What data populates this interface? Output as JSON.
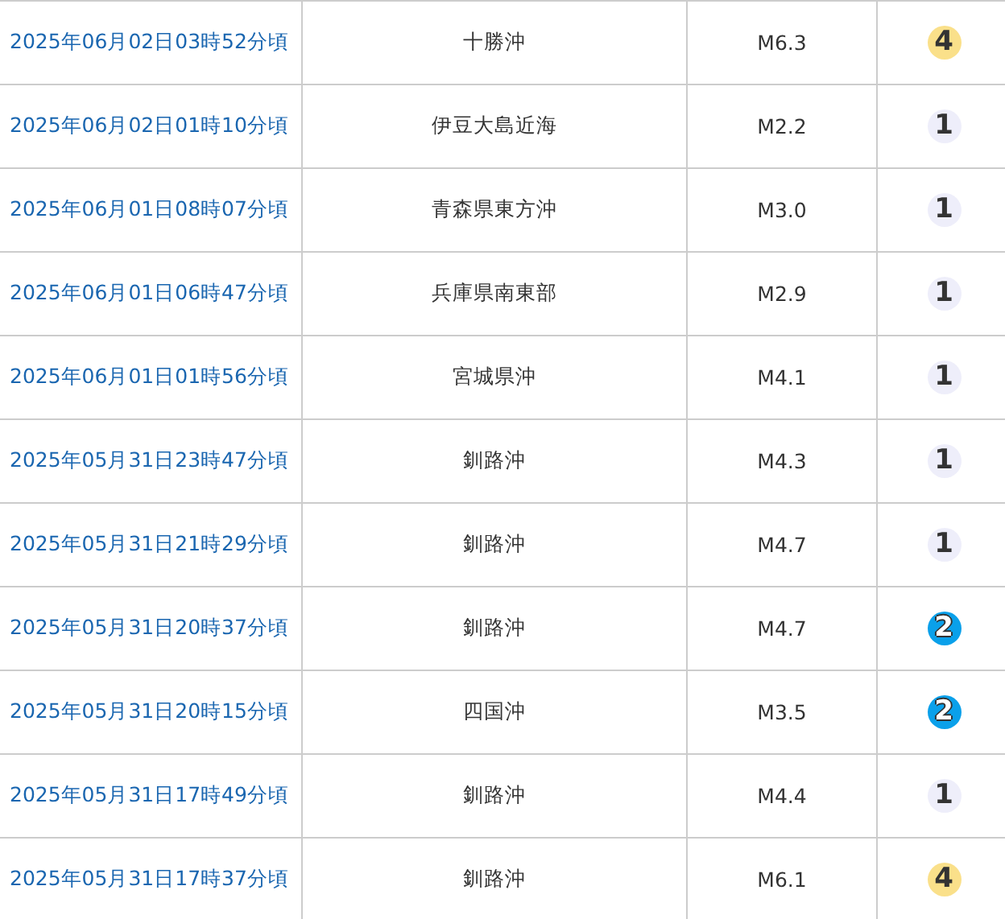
{
  "rows": [
    {
      "time": "2025年06月02日03時52分頃",
      "place": "十勝沖",
      "magnitude": "M6.3",
      "intensity": "4",
      "color": "#fae08a"
    },
    {
      "time": "2025年06月02日01時10分頃",
      "place": "伊豆大島近海",
      "magnitude": "M2.2",
      "intensity": "1",
      "color": "#eeeefa"
    },
    {
      "time": "2025年06月01日08時07分頃",
      "place": "青森県東方沖",
      "magnitude": "M3.0",
      "intensity": "1",
      "color": "#eeeefa"
    },
    {
      "time": "2025年06月01日06時47分頃",
      "place": "兵庫県南東部",
      "magnitude": "M2.9",
      "intensity": "1",
      "color": "#eeeefa"
    },
    {
      "time": "2025年06月01日01時56分頃",
      "place": "宮城県沖",
      "magnitude": "M4.1",
      "intensity": "1",
      "color": "#eeeefa"
    },
    {
      "time": "2025年05月31日23時47分頃",
      "place": "釧路沖",
      "magnitude": "M4.3",
      "intensity": "1",
      "color": "#eeeefa"
    },
    {
      "time": "2025年05月31日21時29分頃",
      "place": "釧路沖",
      "magnitude": "M4.7",
      "intensity": "1",
      "color": "#eeeefa"
    },
    {
      "time": "2025年05月31日20時37分頃",
      "place": "釧路沖",
      "magnitude": "M4.7",
      "intensity": "2",
      "color": "#0aa0ea"
    },
    {
      "time": "2025年05月31日20時15分頃",
      "place": "四国沖",
      "magnitude": "M3.5",
      "intensity": "2",
      "color": "#0aa0ea"
    },
    {
      "time": "2025年05月31日17時49分頃",
      "place": "釧路沖",
      "magnitude": "M4.4",
      "intensity": "1",
      "color": "#eeeefa"
    },
    {
      "time": "2025年05月31日17時37分頃",
      "place": "釧路沖",
      "magnitude": "M6.1",
      "intensity": "4",
      "color": "#fae08a"
    }
  ]
}
